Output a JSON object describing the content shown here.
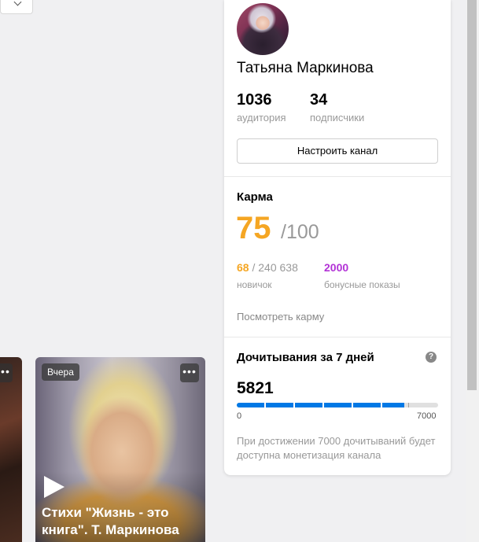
{
  "profile": {
    "name": "Татьяна Маркинова",
    "audience": "1036",
    "audience_label": "аудитория",
    "subscriptions": "34",
    "subscriptions_label": "подписчики",
    "setup_button": "Настроить канал"
  },
  "karma": {
    "heading": "Карма",
    "value": "75",
    "max": "/100",
    "rank": "68",
    "rank_total": " / 240 638",
    "rank_label": "новичок",
    "bonus": "2000",
    "bonus_label": "бонусные показы",
    "link": "Посмотреть карму",
    "colors": {
      "karma": "#f5a623",
      "bonus": "#b232d6"
    }
  },
  "reads": {
    "heading": "Дочитывания за 7 дней",
    "help_icon": "?",
    "value": "5821",
    "min_label": "0",
    "max_label": "7000",
    "progress_fraction": 0.8316,
    "note": "При достижении 7000 дочитываний будет доступна монетизация канала",
    "bar_color": "#0078e5"
  },
  "feed": {
    "card": {
      "badge": "Вчера",
      "more_icon": "•••",
      "title": "Стихи \"Жизнь - это книга\". Т. Маркинова"
    },
    "prev_more_icon": "•••"
  }
}
